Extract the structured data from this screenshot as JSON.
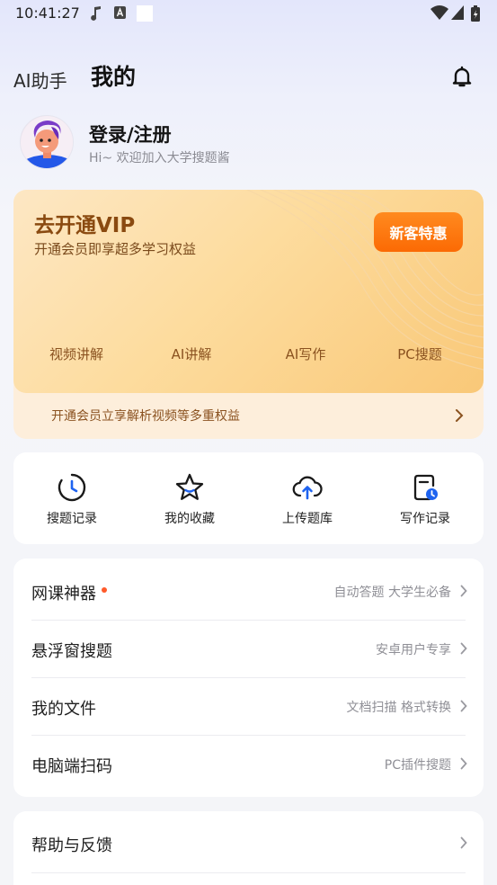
{
  "status_bar": {
    "time": "10:41:27",
    "icons": [
      "music-note-icon",
      "a-icon",
      "blank-square-icon",
      "wifi-icon",
      "signal-icon",
      "battery-icon"
    ]
  },
  "header": {
    "tab_ai": "AI助手",
    "tab_mine": "我的",
    "bell_icon": "bell-icon"
  },
  "profile": {
    "title": "登录/注册",
    "subtitle": "Hi~ 欢迎加入大学搜题酱"
  },
  "vip": {
    "title": "去开通VIP",
    "subtitle": "开通会员即享超多学习权益",
    "button": "新客特惠",
    "features": [
      "视频讲解",
      "AI讲解",
      "AI写作",
      "PC搜题"
    ],
    "promo": "开通会员立享解析视频等多重权益",
    "colors": {
      "accent": "#fb6a04",
      "gold_text": "#8a4a10"
    }
  },
  "tools": [
    {
      "label": "搜题记录",
      "icon": "clock-history-icon"
    },
    {
      "label": "我的收藏",
      "icon": "star-icon"
    },
    {
      "label": "上传题库",
      "icon": "cloud-upload-icon"
    },
    {
      "label": "写作记录",
      "icon": "doc-clock-icon"
    }
  ],
  "menu": [
    {
      "label": "网课神器",
      "desc": "自动答题 大学生必备",
      "dot": true
    },
    {
      "label": "悬浮窗搜题",
      "desc": "安卓用户专享"
    },
    {
      "label": "我的文件",
      "desc": "文档扫描 格式转换"
    },
    {
      "label": "电脑端扫码",
      "desc": "PC插件搜题"
    }
  ],
  "menu2": [
    {
      "label": "帮助与反馈",
      "desc": ""
    }
  ],
  "colors": {
    "icon_blue": "#1e63f0",
    "dot_red": "#ff5a2a"
  }
}
